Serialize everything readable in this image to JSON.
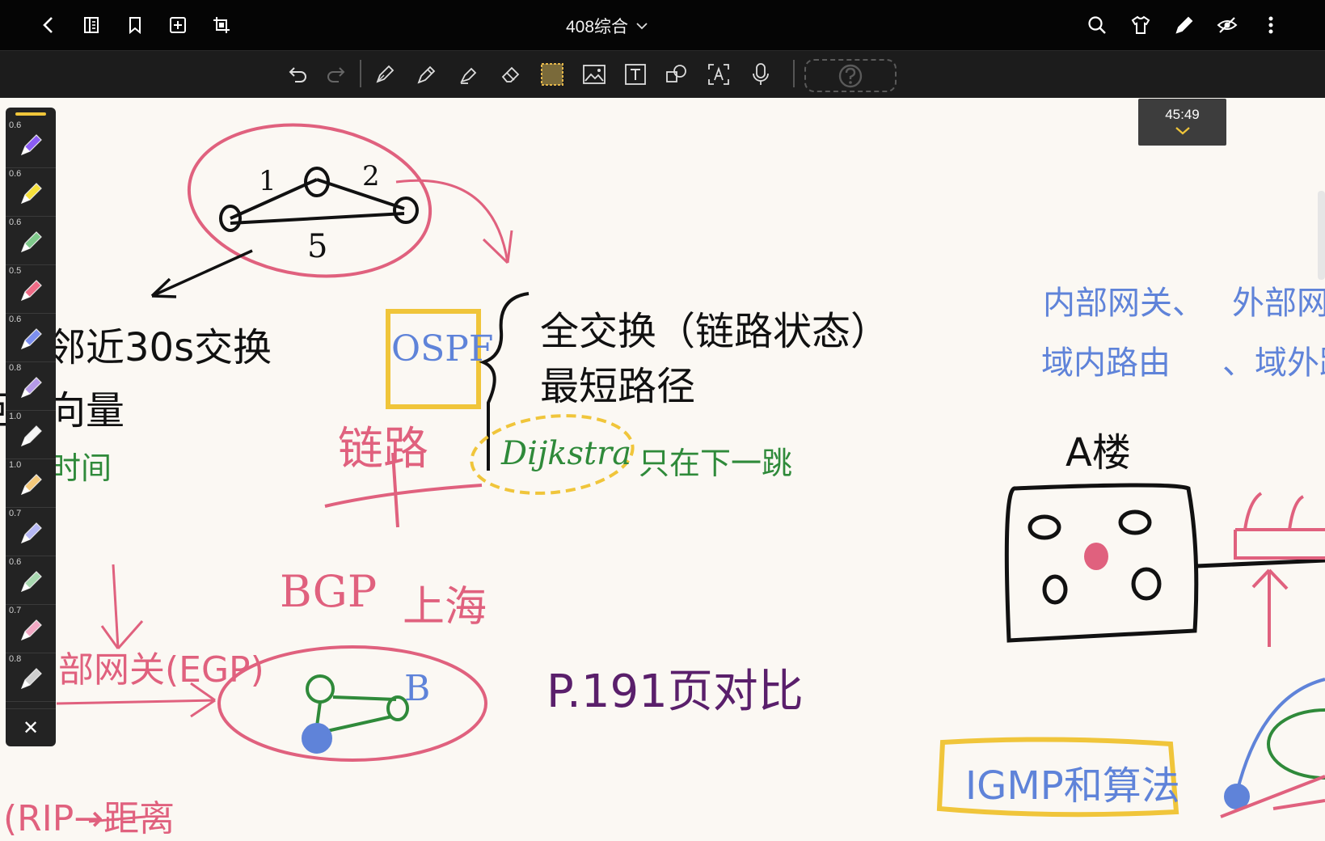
{
  "header": {
    "title": "408综合"
  },
  "timer": {
    "time": "45:49"
  },
  "palette": {
    "sizes": [
      "0.6",
      "0.6",
      "0.6",
      "0.5",
      "0.6",
      "0.8",
      "1.0",
      "1.0",
      "0.7",
      "0.6",
      "0.7",
      "0.8"
    ],
    "colors": [
      "#8b5cf6",
      "#f6e03a",
      "#7fc98b",
      "#ee6b86",
      "#7c8ff0",
      "#b59ae8",
      "#f5f5f5",
      "#f5c97a",
      "#b6b8f5",
      "#a8d8b0",
      "#f2a9c4",
      "#cfcfcf"
    ],
    "close_label": "✕"
  },
  "notes": {
    "ospf": "OSPF",
    "full_exchange": "全交换（链路状态）",
    "shortest_path": "最短路径",
    "link": "链路",
    "dijkstra": "Dijkstra",
    "next_hop": "只在下一跳",
    "left_line1": "邻近30s交换",
    "left_line2": "距离向量",
    "left_line3": "时间",
    "bgp": "BGP",
    "shanghai": "上海",
    "egp": "部网关(EGP)",
    "page_compare": "P.191页对比",
    "rip_bottom": "(RIP→距离",
    "interior_gw": "内部网关、",
    "intra_routing": "域内路由",
    "exterior_gw": "外部网",
    "inter_routing": "、域外路",
    "building_a": "A楼",
    "igmp": "IGMP和算法",
    "node_b": "B",
    "edge_1": "1",
    "edge_2": "2",
    "edge_5": "5"
  },
  "colors": {
    "pink": "#e0617e",
    "black": "#111111",
    "blue": "#5f83d9",
    "green": "#2f8a3a",
    "yellow": "#f0c53a",
    "purple": "#5a1f6b"
  }
}
